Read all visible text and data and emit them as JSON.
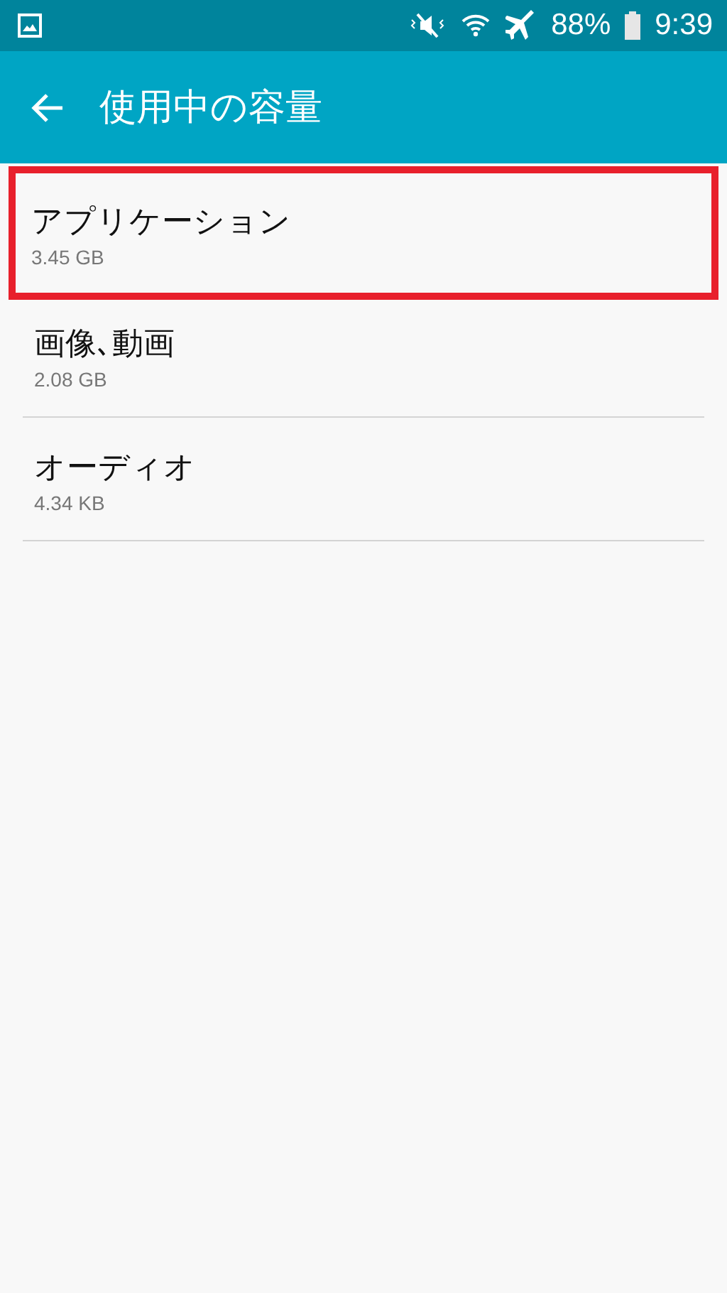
{
  "status_bar": {
    "battery": "88%",
    "time": "9:39"
  },
  "app_bar": {
    "title": "使用中の容量"
  },
  "items": [
    {
      "name": "アプリケーション",
      "size": "3.45 GB",
      "highlighted": true
    },
    {
      "name": "画像､動画",
      "size": "2.08 GB",
      "highlighted": false
    },
    {
      "name": "オーディオ",
      "size": "4.34 KB",
      "highlighted": false
    }
  ]
}
